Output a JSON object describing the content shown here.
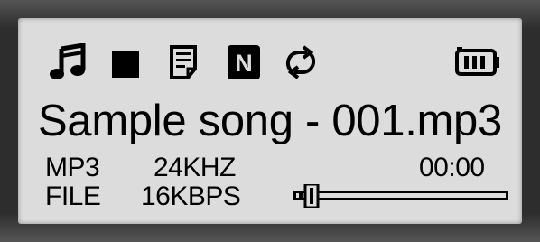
{
  "status_icons": {
    "music": "music-note-icon",
    "state": "stop-icon",
    "mode": "document-icon",
    "eq": "normal-mode-icon",
    "repeat": "repeat-icon",
    "battery": "battery-icon"
  },
  "eq_letter": "N",
  "track": {
    "title": "Sample song - 001.mp3"
  },
  "info": {
    "format": "MP3",
    "sample_rate": "24KHZ",
    "time": "00:00",
    "source": "FILE",
    "bitrate": "16KBPS"
  },
  "progress": {
    "fraction": 0.0
  },
  "colors": {
    "lcd_background": "#dcdcdc",
    "foreground": "#000000",
    "bezel": "#2d2d2d"
  }
}
